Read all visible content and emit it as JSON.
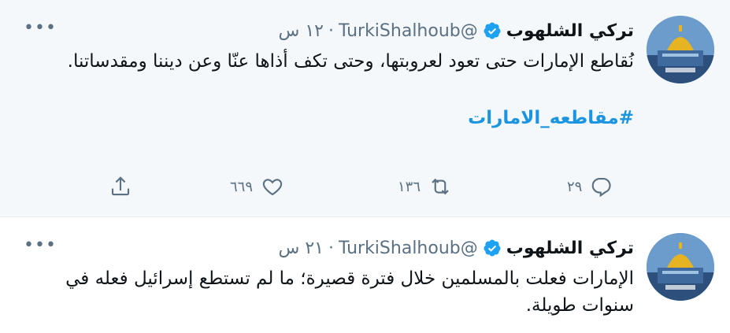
{
  "tweets": [
    {
      "author_name": "تركي الشلهوب",
      "handle": "@TurkiShalhoub",
      "separator": "·",
      "time": "١٢ س",
      "text": "نُقاطع الإمارات حتى تعود لعروبتها، وحتى تكف أذاها عنّا وعن ديننا ومقدساتنا.",
      "hashtag": "#مقاطعه_الامارات",
      "reply_count": "٢٩",
      "retweet_count": "١٣٦",
      "like_count": "٦٦٩",
      "more_label": "•••"
    },
    {
      "author_name": "تركي الشلهوب",
      "handle": "@TurkiShalhoub",
      "separator": "·",
      "time": "٢١ س",
      "text": "الإمارات فعلت بالمسلمين خلال فترة قصيرة؛ ما لم تستطع إسرائيل فعله في سنوات طويلة.",
      "more_label": "•••"
    }
  ],
  "colors": {
    "verified": "#1da1f2",
    "hashtag": "#1b95e0",
    "muted": "#5b7083",
    "highlight_bg": "#f5f8fa"
  },
  "icons": {
    "verified": "verified-badge-icon",
    "reply": "reply-icon",
    "retweet": "retweet-icon",
    "like": "heart-icon",
    "share": "share-icon",
    "more": "more-icon"
  }
}
